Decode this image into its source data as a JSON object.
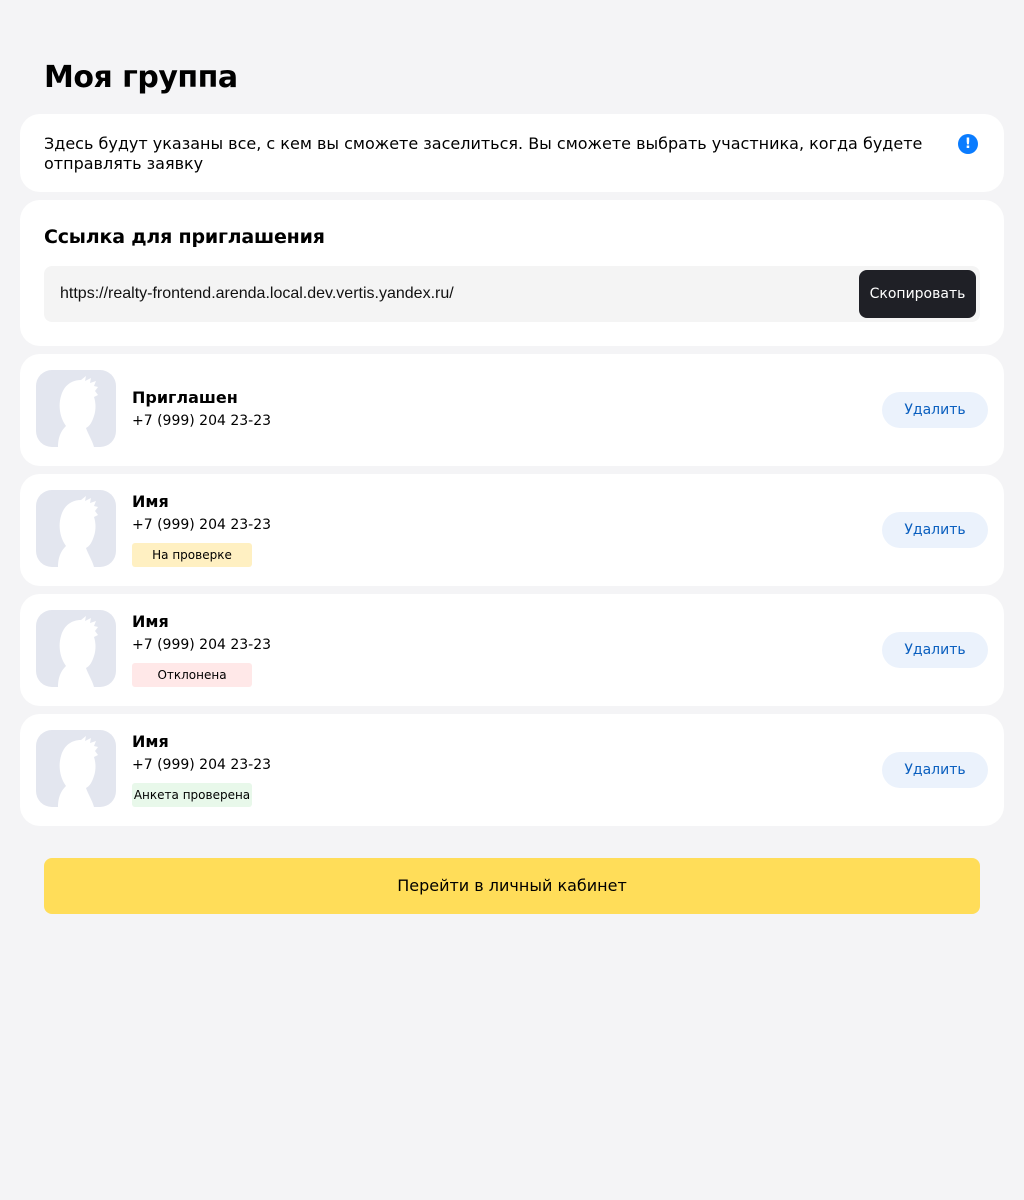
{
  "page": {
    "title": "Моя группа"
  },
  "info": {
    "text": "Здесь будут указаны все, с кем вы сможете заселиться. Вы сможете выбрать участника, когда будете отправлять заявку",
    "icon_symbol": "!",
    "icon": "info-exclamation-icon",
    "icon_color": "#0a7cff"
  },
  "invite": {
    "title": "Ссылка для приглашения",
    "url": "https://realty-frontend.arenda.local.dev.vertis.yandex.ru/",
    "copy_label": "Скопировать"
  },
  "members": [
    {
      "name": "Приглашен",
      "phone": "+7 (999) 204 23-23",
      "status": "",
      "delete_label": "Удалить"
    },
    {
      "name": "Имя",
      "phone": "+7 (999) 204 23-23",
      "status": "На проверке",
      "status_color": "#fff0c2",
      "delete_label": "Удалить"
    },
    {
      "name": "Имя",
      "phone": "+7 (999) 204 23-23",
      "status": "Отклонена",
      "status_color": "#ffe8e8",
      "delete_label": "Удалить"
    },
    {
      "name": "Имя",
      "phone": "+7 (999) 204 23-23",
      "status": "Анкета проверена",
      "status_color": "#e8f8ea",
      "delete_label": "Удалить"
    }
  ],
  "cabinet_button": {
    "label": "Перейти в личный кабинет",
    "color": "#ffdd59"
  }
}
